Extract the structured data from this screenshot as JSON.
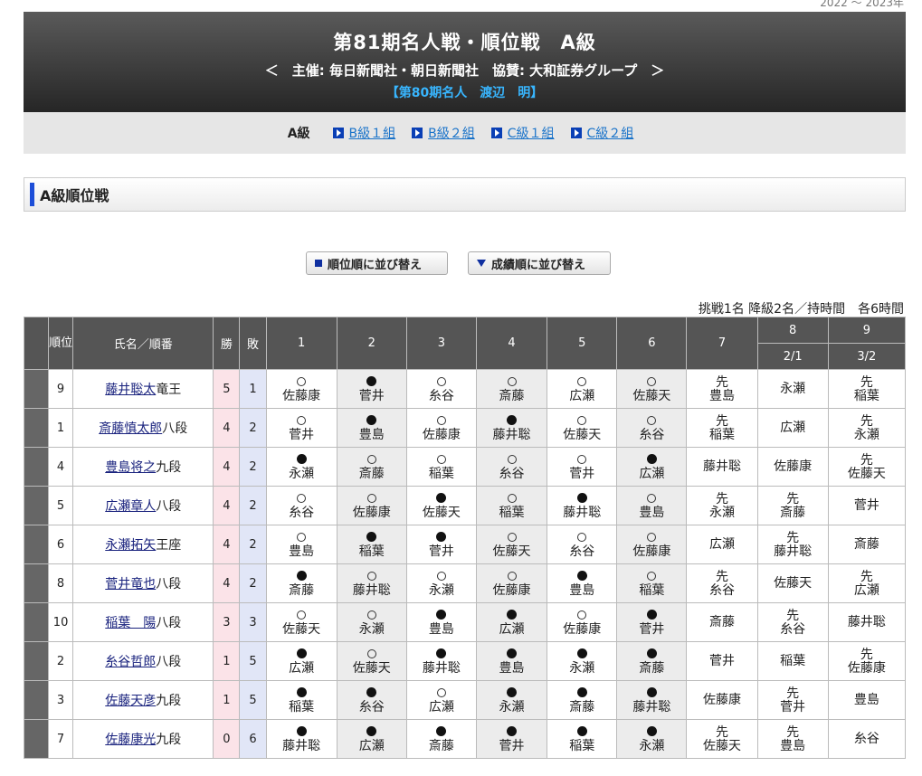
{
  "corner_text": "2022 ～ 2023年",
  "banner": {
    "title": "第81期名人戦・順位戦　A級",
    "sponsor": "＜　主催: 毎日新聞社・朝日新聞社　協賛: 大和証券グループ　＞",
    "champion": "【第80期名人　渡辺　明】"
  },
  "nav": {
    "current": "A級",
    "links": [
      "B級１組",
      "B級２組",
      "C級１組",
      "C級２組"
    ]
  },
  "section_title": "A級順位戦",
  "buttons": {
    "sort_rank": "順位順に並び替え",
    "sort_score": "成績順に並び替え"
  },
  "rules_info": "挑戦1名 降級2名／持時間　各6時間",
  "table": {
    "headers": {
      "rank": "順位",
      "name": "氏名／順番",
      "wins": "勝",
      "losses": "敗",
      "rounds": [
        "1",
        "2",
        "3",
        "4",
        "5",
        "6",
        "7",
        "8",
        "9"
      ],
      "dates": {
        "8": "2/1",
        "9": "3/2"
      }
    },
    "rows": [
      {
        "rank": "9",
        "name": "藤井聡太",
        "title": "竜王",
        "wins": "5",
        "losses": "1",
        "games": [
          {
            "r": "○",
            "opp": "佐藤康"
          },
          {
            "r": "●",
            "opp": "菅井"
          },
          {
            "r": "○",
            "opp": "糸谷"
          },
          {
            "r": "○",
            "opp": "斎藤"
          },
          {
            "r": "○",
            "opp": "広瀬"
          },
          {
            "r": "○",
            "opp": "佐藤天"
          },
          {
            "r": "先",
            "opp": "豊島"
          },
          {
            "r": "",
            "opp": "永瀬"
          },
          {
            "r": "先",
            "opp": "稲葉"
          }
        ]
      },
      {
        "rank": "1",
        "name": "斎藤慎太郎",
        "title": "八段",
        "wins": "4",
        "losses": "2",
        "games": [
          {
            "r": "○",
            "opp": "菅井"
          },
          {
            "r": "●",
            "opp": "豊島"
          },
          {
            "r": "○",
            "opp": "佐藤康"
          },
          {
            "r": "●",
            "opp": "藤井聡"
          },
          {
            "r": "○",
            "opp": "佐藤天"
          },
          {
            "r": "○",
            "opp": "糸谷"
          },
          {
            "r": "先",
            "opp": "稲葉"
          },
          {
            "r": "",
            "opp": "広瀬"
          },
          {
            "r": "先",
            "opp": "永瀬"
          }
        ]
      },
      {
        "rank": "4",
        "name": "豊島将之",
        "title": "九段",
        "wins": "4",
        "losses": "2",
        "games": [
          {
            "r": "●",
            "opp": "永瀬"
          },
          {
            "r": "○",
            "opp": "斎藤"
          },
          {
            "r": "○",
            "opp": "稲葉"
          },
          {
            "r": "○",
            "opp": "糸谷"
          },
          {
            "r": "○",
            "opp": "菅井"
          },
          {
            "r": "●",
            "opp": "広瀬"
          },
          {
            "r": "",
            "opp": "藤井聡"
          },
          {
            "r": "",
            "opp": "佐藤康"
          },
          {
            "r": "先",
            "opp": "佐藤天"
          }
        ]
      },
      {
        "rank": "5",
        "name": "広瀬章人",
        "title": "八段",
        "wins": "4",
        "losses": "2",
        "games": [
          {
            "r": "○",
            "opp": "糸谷"
          },
          {
            "r": "○",
            "opp": "佐藤康"
          },
          {
            "r": "●",
            "opp": "佐藤天"
          },
          {
            "r": "○",
            "opp": "稲葉"
          },
          {
            "r": "●",
            "opp": "藤井聡"
          },
          {
            "r": "○",
            "opp": "豊島"
          },
          {
            "r": "先",
            "opp": "永瀬"
          },
          {
            "r": "先",
            "opp": "斎藤"
          },
          {
            "r": "",
            "opp": "菅井"
          }
        ]
      },
      {
        "rank": "6",
        "name": "永瀬拓矢",
        "title": "王座",
        "wins": "4",
        "losses": "2",
        "games": [
          {
            "r": "○",
            "opp": "豊島"
          },
          {
            "r": "●",
            "opp": "稲葉"
          },
          {
            "r": "●",
            "opp": "菅井"
          },
          {
            "r": "○",
            "opp": "佐藤天"
          },
          {
            "r": "○",
            "opp": "糸谷"
          },
          {
            "r": "○",
            "opp": "佐藤康"
          },
          {
            "r": "",
            "opp": "広瀬"
          },
          {
            "r": "先",
            "opp": "藤井聡"
          },
          {
            "r": "",
            "opp": "斎藤"
          }
        ]
      },
      {
        "rank": "8",
        "name": "菅井竜也",
        "title": "八段",
        "wins": "4",
        "losses": "2",
        "games": [
          {
            "r": "●",
            "opp": "斎藤"
          },
          {
            "r": "○",
            "opp": "藤井聡"
          },
          {
            "r": "○",
            "opp": "永瀬"
          },
          {
            "r": "○",
            "opp": "佐藤康"
          },
          {
            "r": "●",
            "opp": "豊島"
          },
          {
            "r": "○",
            "opp": "稲葉"
          },
          {
            "r": "先",
            "opp": "糸谷"
          },
          {
            "r": "",
            "opp": "佐藤天"
          },
          {
            "r": "先",
            "opp": "広瀬"
          }
        ]
      },
      {
        "rank": "10",
        "name": "稲葉　陽",
        "title": "八段",
        "wins": "3",
        "losses": "3",
        "games": [
          {
            "r": "○",
            "opp": "佐藤天"
          },
          {
            "r": "○",
            "opp": "永瀬"
          },
          {
            "r": "●",
            "opp": "豊島"
          },
          {
            "r": "●",
            "opp": "広瀬"
          },
          {
            "r": "○",
            "opp": "佐藤康"
          },
          {
            "r": "●",
            "opp": "菅井"
          },
          {
            "r": "",
            "opp": "斎藤"
          },
          {
            "r": "先",
            "opp": "糸谷"
          },
          {
            "r": "",
            "opp": "藤井聡"
          }
        ]
      },
      {
        "rank": "2",
        "name": "糸谷哲郎",
        "title": "八段",
        "wins": "1",
        "losses": "5",
        "games": [
          {
            "r": "●",
            "opp": "広瀬"
          },
          {
            "r": "○",
            "opp": "佐藤天"
          },
          {
            "r": "●",
            "opp": "藤井聡"
          },
          {
            "r": "●",
            "opp": "豊島"
          },
          {
            "r": "●",
            "opp": "永瀬"
          },
          {
            "r": "●",
            "opp": "斎藤"
          },
          {
            "r": "",
            "opp": "菅井"
          },
          {
            "r": "",
            "opp": "稲葉"
          },
          {
            "r": "先",
            "opp": "佐藤康"
          }
        ]
      },
      {
        "rank": "3",
        "name": "佐藤天彦",
        "title": "九段",
        "wins": "1",
        "losses": "5",
        "games": [
          {
            "r": "●",
            "opp": "稲葉"
          },
          {
            "r": "●",
            "opp": "糸谷"
          },
          {
            "r": "○",
            "opp": "広瀬"
          },
          {
            "r": "●",
            "opp": "永瀬"
          },
          {
            "r": "●",
            "opp": "斎藤"
          },
          {
            "r": "●",
            "opp": "藤井聡"
          },
          {
            "r": "",
            "opp": "佐藤康"
          },
          {
            "r": "先",
            "opp": "菅井"
          },
          {
            "r": "",
            "opp": "豊島"
          }
        ]
      },
      {
        "rank": "7",
        "name": "佐藤康光",
        "title": "九段",
        "wins": "0",
        "losses": "6",
        "games": [
          {
            "r": "●",
            "opp": "藤井聡"
          },
          {
            "r": "●",
            "opp": "広瀬"
          },
          {
            "r": "●",
            "opp": "斎藤"
          },
          {
            "r": "●",
            "opp": "菅井"
          },
          {
            "r": "●",
            "opp": "稲葉"
          },
          {
            "r": "●",
            "opp": "永瀬"
          },
          {
            "r": "先",
            "opp": "佐藤天"
          },
          {
            "r": "先",
            "opp": "豊島"
          },
          {
            "r": "",
            "opp": "糸谷"
          }
        ]
      }
    ]
  }
}
